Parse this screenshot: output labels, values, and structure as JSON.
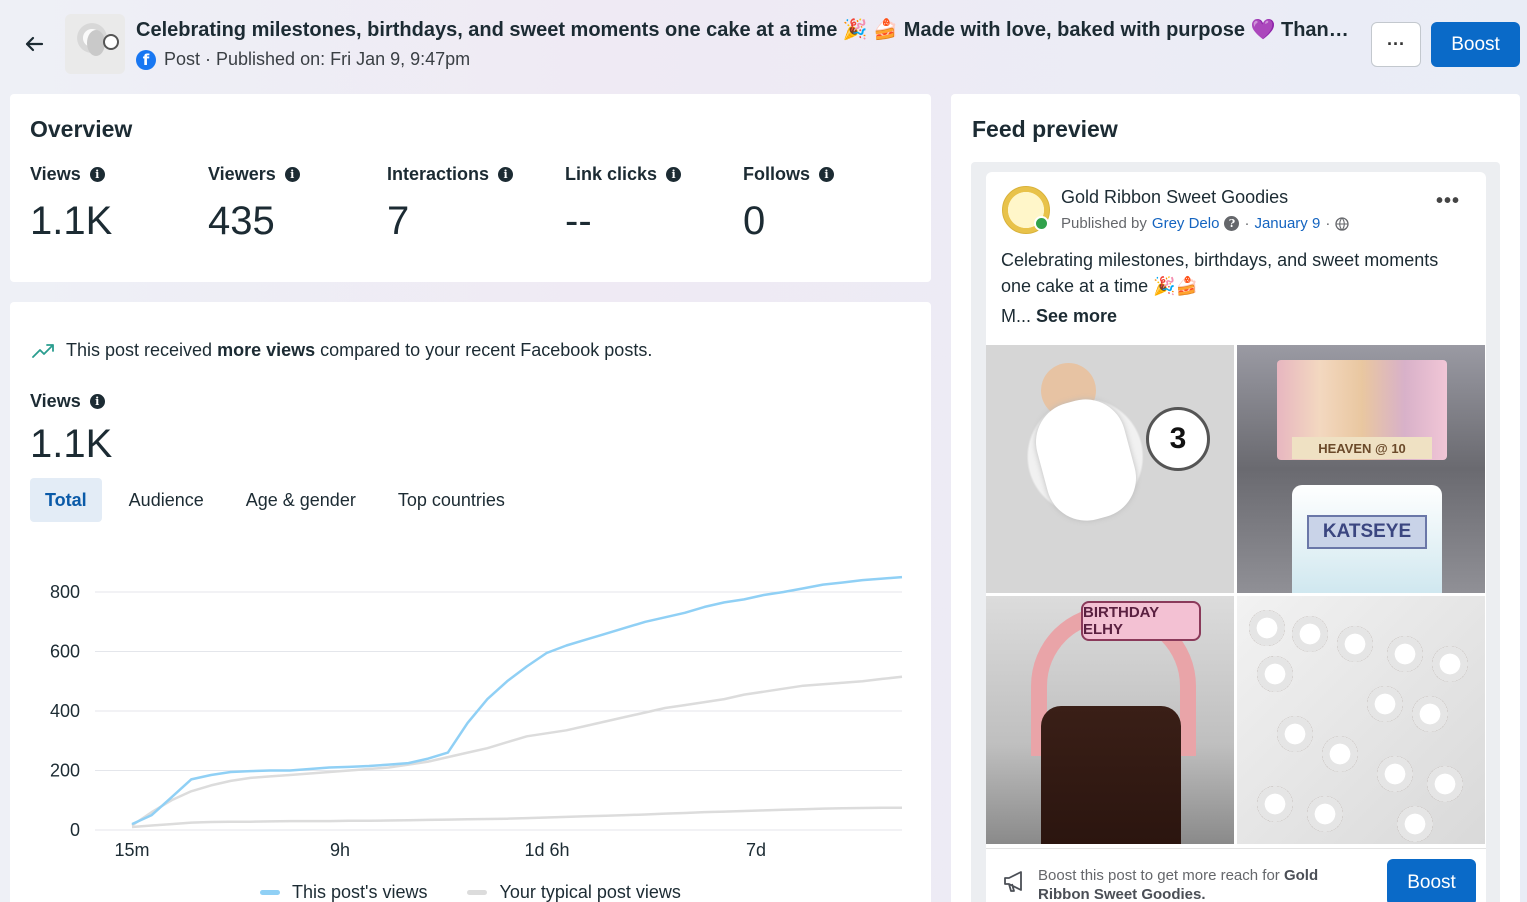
{
  "header": {
    "post_title": "Celebrating milestones, birthdays, and sweet moments one cake at a time 🎉 🍰 Made with love, baked with purpose 💜 Thank yo...",
    "post_meta": "Post · Published on: Fri Jan 9, 9:47pm",
    "more_label": "···",
    "boost_label": "Boost"
  },
  "overview": {
    "title": "Overview",
    "metrics": [
      {
        "label": "Views",
        "value": "1.1K"
      },
      {
        "label": "Viewers",
        "value": "435"
      },
      {
        "label": "Interactions",
        "value": "7"
      },
      {
        "label": "Link clicks",
        "value": "--"
      },
      {
        "label": "Follows",
        "value": "0"
      }
    ]
  },
  "views_panel": {
    "insight_prefix": "This post received ",
    "insight_bold": "more views",
    "insight_suffix": " compared to your recent Facebook posts.",
    "label": "Views",
    "value": "1.1K",
    "tabs": [
      "Total",
      "Audience",
      "Age & gender",
      "Top countries"
    ],
    "active_tab": "Total"
  },
  "chart_data": {
    "type": "line",
    "x_tick_labels": [
      "15m",
      "9h",
      "1d 6h",
      "7d"
    ],
    "y_ticks": [
      0,
      200,
      400,
      600,
      800
    ],
    "ylim": [
      0,
      850
    ],
    "grid": true,
    "legend_position": "bottom",
    "series": [
      {
        "name": "This post's views",
        "color": "#90d0f5",
        "values": [
          20,
          50,
          110,
          170,
          185,
          195,
          198,
          200,
          200,
          205,
          210,
          212,
          215,
          220,
          225,
          240,
          260,
          360,
          440,
          500,
          550,
          595,
          620,
          640,
          660,
          680,
          700,
          715,
          730,
          750,
          765,
          775,
          790,
          800,
          812,
          825,
          832,
          840,
          845,
          850
        ]
      },
      {
        "name": "Your typical post views",
        "color": "#dcdcdc",
        "values": [
          15,
          60,
          100,
          130,
          150,
          165,
          175,
          180,
          185,
          190,
          195,
          200,
          205,
          210,
          220,
          230,
          245,
          260,
          275,
          295,
          315,
          325,
          335,
          350,
          365,
          380,
          395,
          410,
          420,
          430,
          440,
          455,
          465,
          475,
          485,
          490,
          495,
          500,
          508,
          515
        ]
      },
      {
        "name": "",
        "color": "#dcdcdc",
        "values": [
          10,
          15,
          20,
          25,
          27,
          28,
          28,
          29,
          30,
          30,
          30,
          31,
          31,
          32,
          33,
          34,
          35,
          36,
          37,
          38,
          40,
          42,
          44,
          46,
          48,
          50,
          52,
          55,
          57,
          60,
          62,
          64,
          66,
          68,
          70,
          72,
          73,
          74,
          75,
          75
        ]
      }
    ]
  },
  "feed_preview": {
    "title": "Feed preview",
    "page_name": "Gold Ribbon Sweet Goodies",
    "published_by_prefix": "Published by",
    "author": "Grey Delo",
    "date": "January 9",
    "post_text": "Celebrating milestones, birthdays, and sweet moments one cake at a time 🎉🍰",
    "see_more_prefix": "M...",
    "see_more_label": "See more",
    "photo_labels": {
      "disc": "3",
      "cake_name": "KATSEYE",
      "banner": "HEAVEN @ 10",
      "birthday": "BIRTHDAY ELHY"
    },
    "boost_prompt_prefix": "Boost this post to get more reach for",
    "boost_prompt_page": "Gold Ribbon Sweet Goodies.",
    "boost_label": "Boost"
  }
}
